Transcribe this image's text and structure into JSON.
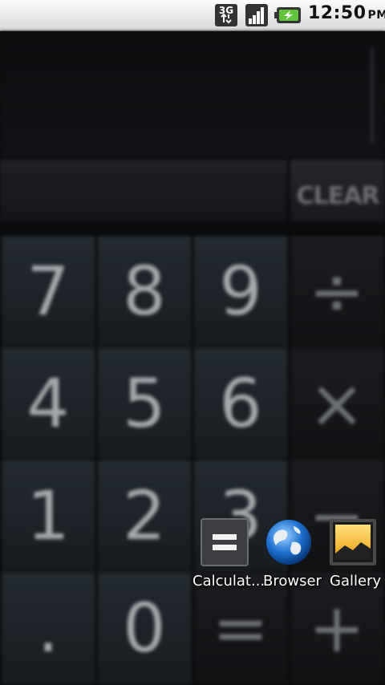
{
  "status_bar": {
    "network": "3G",
    "time": "12:50",
    "ampm": "PM",
    "battery_icon": "battery-charging-icon",
    "signal_icon": "signal-bars-icon"
  },
  "calculator": {
    "clear_label": "CLEAR",
    "keys": [
      "7",
      "8",
      "9",
      "÷",
      "4",
      "5",
      "6",
      "×",
      "1",
      "2",
      "3",
      "−",
      ".",
      "0",
      "=",
      "+"
    ]
  },
  "apps": [
    {
      "label": "Calculat...",
      "icon": "calculator-icon"
    },
    {
      "label": "Browser",
      "icon": "globe-icon"
    },
    {
      "label": "Gallery",
      "icon": "gallery-icon"
    }
  ],
  "colors": {
    "statusbar_bg": "#f0f0f0",
    "key_bg": "#1f262b",
    "key_text": "#a3a8ad",
    "app_label": "#ffffff"
  }
}
